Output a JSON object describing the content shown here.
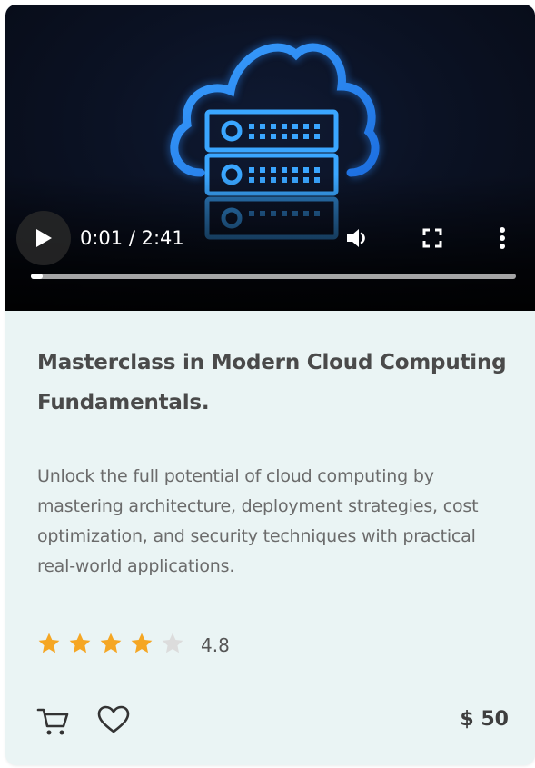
{
  "video": {
    "current_time": "0:01",
    "duration": "2:41",
    "time_display": "0:01 / 2:41",
    "progress_fraction": 0.006,
    "thumbnail_icon": "cloud-server-icon",
    "controls": {
      "play": "play-icon",
      "volume": "volume-icon",
      "fullscreen": "fullscreen-icon",
      "more": "more-vertical-icon"
    }
  },
  "course": {
    "title": "Masterclass in Modern Cloud Computing Fundamentals.",
    "description": "Unlock the full potential of cloud computing by mastering architecture, deployment strategies, cost optimization, and security techniques with practical real-world applications.",
    "rating": {
      "value": "4.8",
      "stars_filled": 4,
      "stars_total": 5
    },
    "price": "$ 50"
  },
  "actions": {
    "cart_icon": "cart-icon",
    "wishlist_icon": "heart-icon"
  },
  "colors": {
    "card_bg": "#eaf4f4",
    "star_filled": "#f5a623",
    "star_empty": "#dcdcdc",
    "cloud_glow": "#1e90ff"
  }
}
